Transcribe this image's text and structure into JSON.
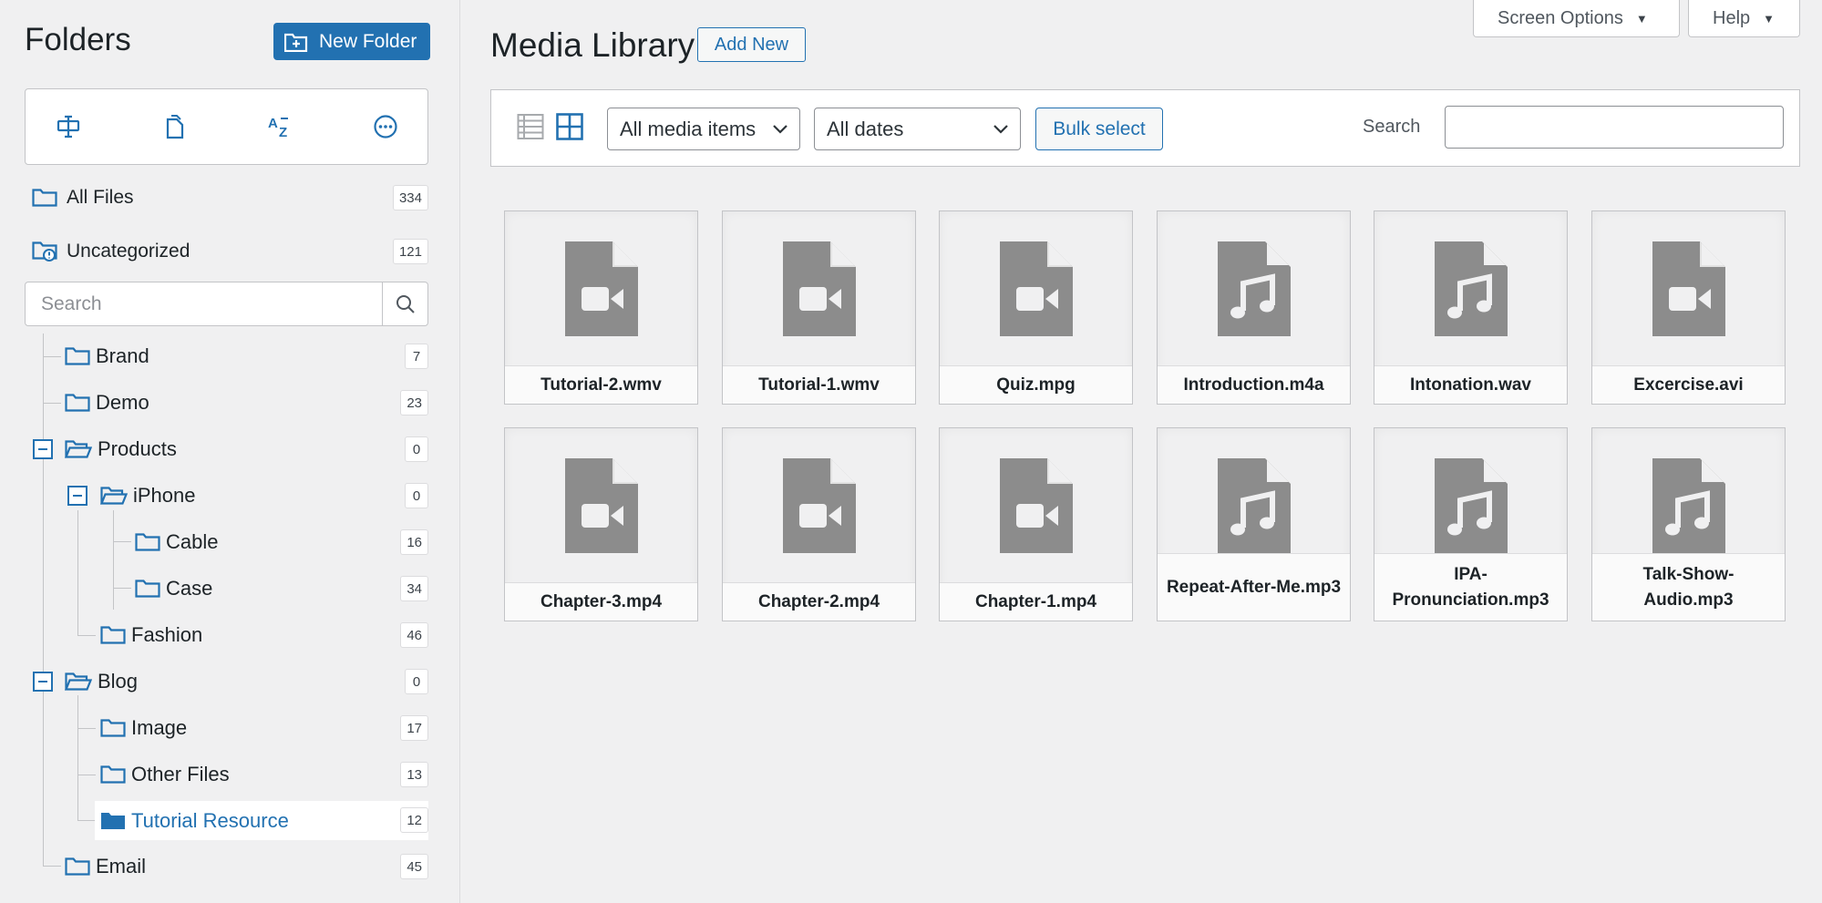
{
  "sidebar": {
    "title": "Folders",
    "new_folder_label": "New Folder",
    "toolbar_icons": [
      "rename-icon",
      "new-file-icon",
      "sort-az-icon",
      "more-icon"
    ],
    "all_files": {
      "label": "All Files",
      "count": "334"
    },
    "uncategorized": {
      "label": "Uncategorized",
      "count": "121"
    },
    "search_placeholder": "Search",
    "tree": [
      {
        "label": "Brand",
        "count": "7"
      },
      {
        "label": "Demo",
        "count": "23"
      },
      {
        "label": "Products",
        "count": "0"
      },
      {
        "label": "iPhone",
        "count": "0"
      },
      {
        "label": "Cable",
        "count": "16"
      },
      {
        "label": "Case",
        "count": "34"
      },
      {
        "label": "Fashion",
        "count": "46"
      },
      {
        "label": "Blog",
        "count": "0"
      },
      {
        "label": "Image",
        "count": "17"
      },
      {
        "label": "Other Files",
        "count": "13"
      },
      {
        "label": "Tutorial Resource",
        "count": "12"
      },
      {
        "label": "Email",
        "count": "45"
      }
    ]
  },
  "header": {
    "title": "Media Library",
    "add_new_label": "Add New",
    "screen_options_label": "Screen Options",
    "help_label": "Help"
  },
  "filters": {
    "media_type_value": "All media items",
    "dates_value": "All dates",
    "bulk_select_label": "Bulk select",
    "search_label": "Search",
    "search_value": ""
  },
  "media": [
    {
      "name": "Tutorial-2.wmv",
      "kind": "video"
    },
    {
      "name": "Tutorial-1.wmv",
      "kind": "video"
    },
    {
      "name": "Quiz.mpg",
      "kind": "video"
    },
    {
      "name": "Introduction.m4a",
      "kind": "audio"
    },
    {
      "name": "Intonation.wav",
      "kind": "audio"
    },
    {
      "name": "Excercise.avi",
      "kind": "video"
    },
    {
      "name": "Chapter-3.mp4",
      "kind": "video"
    },
    {
      "name": "Chapter-2.mp4",
      "kind": "video"
    },
    {
      "name": "Chapter-1.mp4",
      "kind": "video"
    },
    {
      "name": "Repeat-After-Me.mp3",
      "kind": "audio"
    },
    {
      "name": "IPA-Pronunciation.mp3",
      "kind": "audio"
    },
    {
      "name": "Talk-Show-Audio.mp3",
      "kind": "audio"
    }
  ],
  "colors": {
    "accent": "#2271b1",
    "background": "#f0f0f1",
    "file_icon": "#8c8c8c"
  }
}
